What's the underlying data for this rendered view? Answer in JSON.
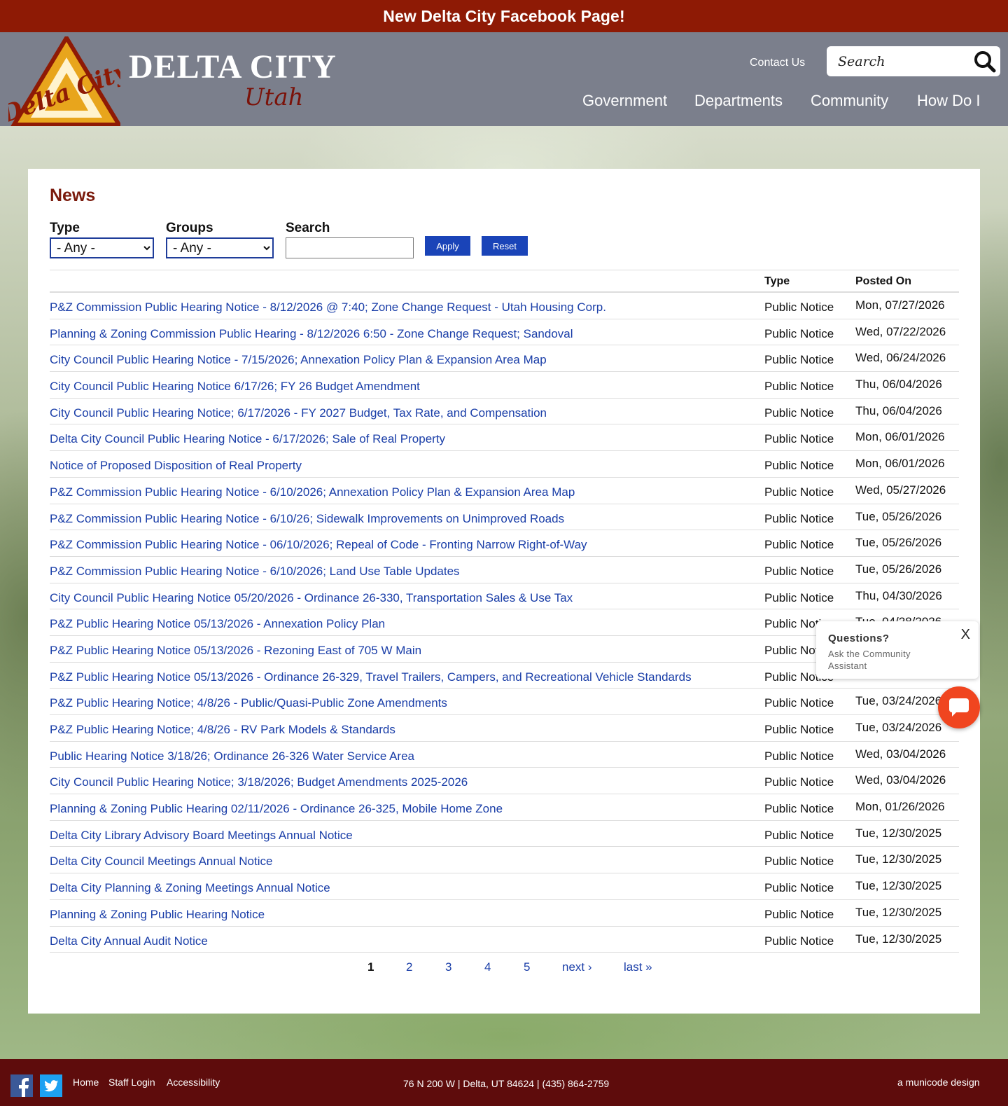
{
  "banner": {
    "text": "New Delta City Facebook Page!"
  },
  "header": {
    "logo_text": "Delta City",
    "title": "DELTA CITY",
    "subtitle": "Utah",
    "contact_label": "Contact Us",
    "search_placeholder": "Search",
    "nav": [
      "Government",
      "Departments",
      "Community",
      "How Do I"
    ]
  },
  "news": {
    "title": "News",
    "filters": {
      "type_label": "Type",
      "type_value": "- Any -",
      "groups_label": "Groups",
      "groups_value": "- Any -",
      "search_label": "Search",
      "apply_label": "Apply",
      "reset_label": "Reset"
    },
    "columns": {
      "type": "Type",
      "posted": "Posted On"
    },
    "rows": [
      {
        "title": "P&Z Commission Public Hearing Notice - 8/12/2026 @ 7:40; Zone Change Request - Utah Housing Corp.",
        "type": "Public Notice",
        "date": "Mon, 07/27/2026"
      },
      {
        "title": "Planning & Zoning Commission Public Hearing - 8/12/2026 6:50 - Zone Change Request; Sandoval",
        "type": "Public Notice",
        "date": "Wed, 07/22/2026"
      },
      {
        "title": "City Council Public Hearing Notice - 7/15/2026; Annexation Policy Plan & Expansion Area Map",
        "type": "Public Notice",
        "date": "Wed, 06/24/2026"
      },
      {
        "title": "City Council Public Hearing Notice 6/17/26; FY 26 Budget Amendment",
        "type": "Public Notice",
        "date": "Thu, 06/04/2026"
      },
      {
        "title": "City Council Public Hearing Notice; 6/17/2026 - FY 2027 Budget, Tax Rate, and Compensation",
        "type": "Public Notice",
        "date": "Thu, 06/04/2026"
      },
      {
        "title": "Delta City Council Public Hearing Notice - 6/17/2026; Sale of Real Property",
        "type": "Public Notice",
        "date": "Mon, 06/01/2026"
      },
      {
        "title": "Notice of Proposed Disposition of Real Property",
        "type": "Public Notice",
        "date": "Mon, 06/01/2026"
      },
      {
        "title": "P&Z Commission Public Hearing Notice - 6/10/2026; Annexation Policy Plan & Expansion Area Map",
        "type": "Public Notice",
        "date": "Wed, 05/27/2026"
      },
      {
        "title": "P&Z Commission Public Hearing Notice - 6/10/26; Sidewalk Improvements on Unimproved Roads",
        "type": "Public Notice",
        "date": "Tue, 05/26/2026"
      },
      {
        "title": "P&Z Commission Public Hearing Notice - 06/10/2026; Repeal of Code - Fronting Narrow Right-of-Way",
        "type": "Public Notice",
        "date": "Tue, 05/26/2026"
      },
      {
        "title": "P&Z Commission Public Hearing Notice - 6/10/2026; Land Use Table Updates",
        "type": "Public Notice",
        "date": "Tue, 05/26/2026"
      },
      {
        "title": "City Council Public Hearing Notice 05/20/2026 - Ordinance 26-330, Transportation Sales & Use Tax",
        "type": "Public Notice",
        "date": "Thu, 04/30/2026"
      },
      {
        "title": "P&Z Public Hearing Notice 05/13/2026 - Annexation Policy Plan",
        "type": "Public Notice",
        "date": "Tue, 04/28/2026"
      },
      {
        "title": "P&Z Public Hearing Notice 05/13/2026 - Rezoning East of 705 W Main",
        "type": "Public Notice",
        "date": ""
      },
      {
        "title": "P&Z Public Hearing Notice 05/13/2026 - Ordinance 26-329, Travel Trailers, Campers, and Recreational Vehicle Standards",
        "type": "Public Notice",
        "date": ""
      },
      {
        "title": "P&Z Public Hearing Notice; 4/8/26 - Public/Quasi-Public Zone Amendments",
        "type": "Public Notice",
        "date": "Tue, 03/24/2026"
      },
      {
        "title": "P&Z Public Hearing Notice; 4/8/26 - RV Park Models & Standards",
        "type": "Public Notice",
        "date": "Tue, 03/24/2026"
      },
      {
        "title": "Public Hearing Notice 3/18/26; Ordinance 26-326 Water Service Area",
        "type": "Public Notice",
        "date": "Wed, 03/04/2026"
      },
      {
        "title": "City Council Public Hearing Notice; 3/18/2026; Budget Amendments 2025-2026",
        "type": "Public Notice",
        "date": "Wed, 03/04/2026"
      },
      {
        "title": "Planning & Zoning Public Hearing 02/11/2026 - Ordinance 26-325, Mobile Home Zone",
        "type": "Public Notice",
        "date": "Mon, 01/26/2026"
      },
      {
        "title": "Delta City Library Advisory Board Meetings Annual Notice",
        "type": "Public Notice",
        "date": "Tue, 12/30/2025"
      },
      {
        "title": "Delta City Council Meetings Annual Notice",
        "type": "Public Notice",
        "date": "Tue, 12/30/2025"
      },
      {
        "title": "Delta City Planning & Zoning Meetings Annual Notice",
        "type": "Public Notice",
        "date": "Tue, 12/30/2025"
      },
      {
        "title": "Planning & Zoning Public Hearing Notice",
        "type": "Public Notice",
        "date": "Tue, 12/30/2025"
      },
      {
        "title": "Delta City Annual Audit Notice",
        "type": "Public Notice",
        "date": "Tue, 12/30/2025"
      }
    ],
    "pager": {
      "current": "1",
      "pages": [
        "2",
        "3",
        "4",
        "5"
      ],
      "next": "next ›",
      "last": "last »"
    }
  },
  "chat": {
    "title": "Questions?",
    "subtitle": "Ask the Community Assistant",
    "close": "X"
  },
  "footer": {
    "links": [
      "Home",
      "Staff Login",
      "Accessibility"
    ],
    "address": "76 N 200 W | Delta, UT 84624 | (435) 864-2759",
    "credit": "a municode design"
  },
  "colors": {
    "banner": "#8e1a05",
    "header": "#7b7f8c",
    "title_red": "#7a1a0c",
    "link_blue": "#1a3ea8",
    "button_blue": "#1a44b8",
    "chat_orange": "#f0451f",
    "footer": "#5e0c0c"
  }
}
